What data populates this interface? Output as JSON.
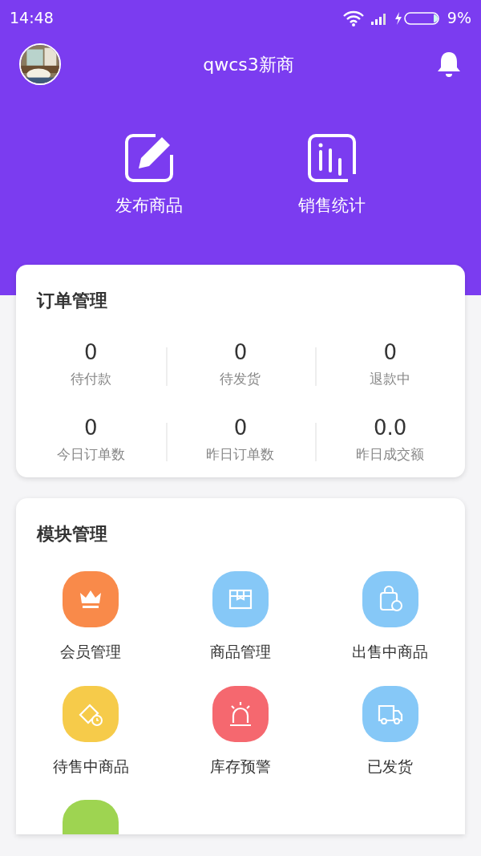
{
  "status_bar": {
    "time": "14:48",
    "battery": "9%"
  },
  "header": {
    "title": "qwcs3新商"
  },
  "quick_actions": [
    {
      "kind": "edit",
      "label": "发布商品"
    },
    {
      "kind": "chart",
      "label": "销售统计"
    }
  ],
  "orders": {
    "title": "订单管理",
    "stats": [
      {
        "value": "0",
        "label": "待付款"
      },
      {
        "value": "0",
        "label": "待发货"
      },
      {
        "value": "0",
        "label": "退款中"
      },
      {
        "value": "0",
        "label": "今日订单数"
      },
      {
        "value": "0",
        "label": "昨日订单数"
      },
      {
        "value": "0.0",
        "label": "昨日成交额"
      }
    ]
  },
  "modules": {
    "title": "模块管理",
    "items": [
      {
        "kind": "crown",
        "color": "#f98a4a",
        "label": "会员管理"
      },
      {
        "kind": "box",
        "color": "#86c8f7",
        "label": "商品管理"
      },
      {
        "kind": "bag",
        "color": "#86c8f7",
        "label": "出售中商品"
      },
      {
        "kind": "tag",
        "color": "#f6cb4a",
        "label": "待售中商品"
      },
      {
        "kind": "alarm",
        "color": "#f5686f",
        "label": "库存预警"
      },
      {
        "kind": "truck",
        "color": "#86c8f7",
        "label": "已发货"
      },
      {
        "kind": "blank",
        "color": "#9ed451"
      }
    ]
  }
}
